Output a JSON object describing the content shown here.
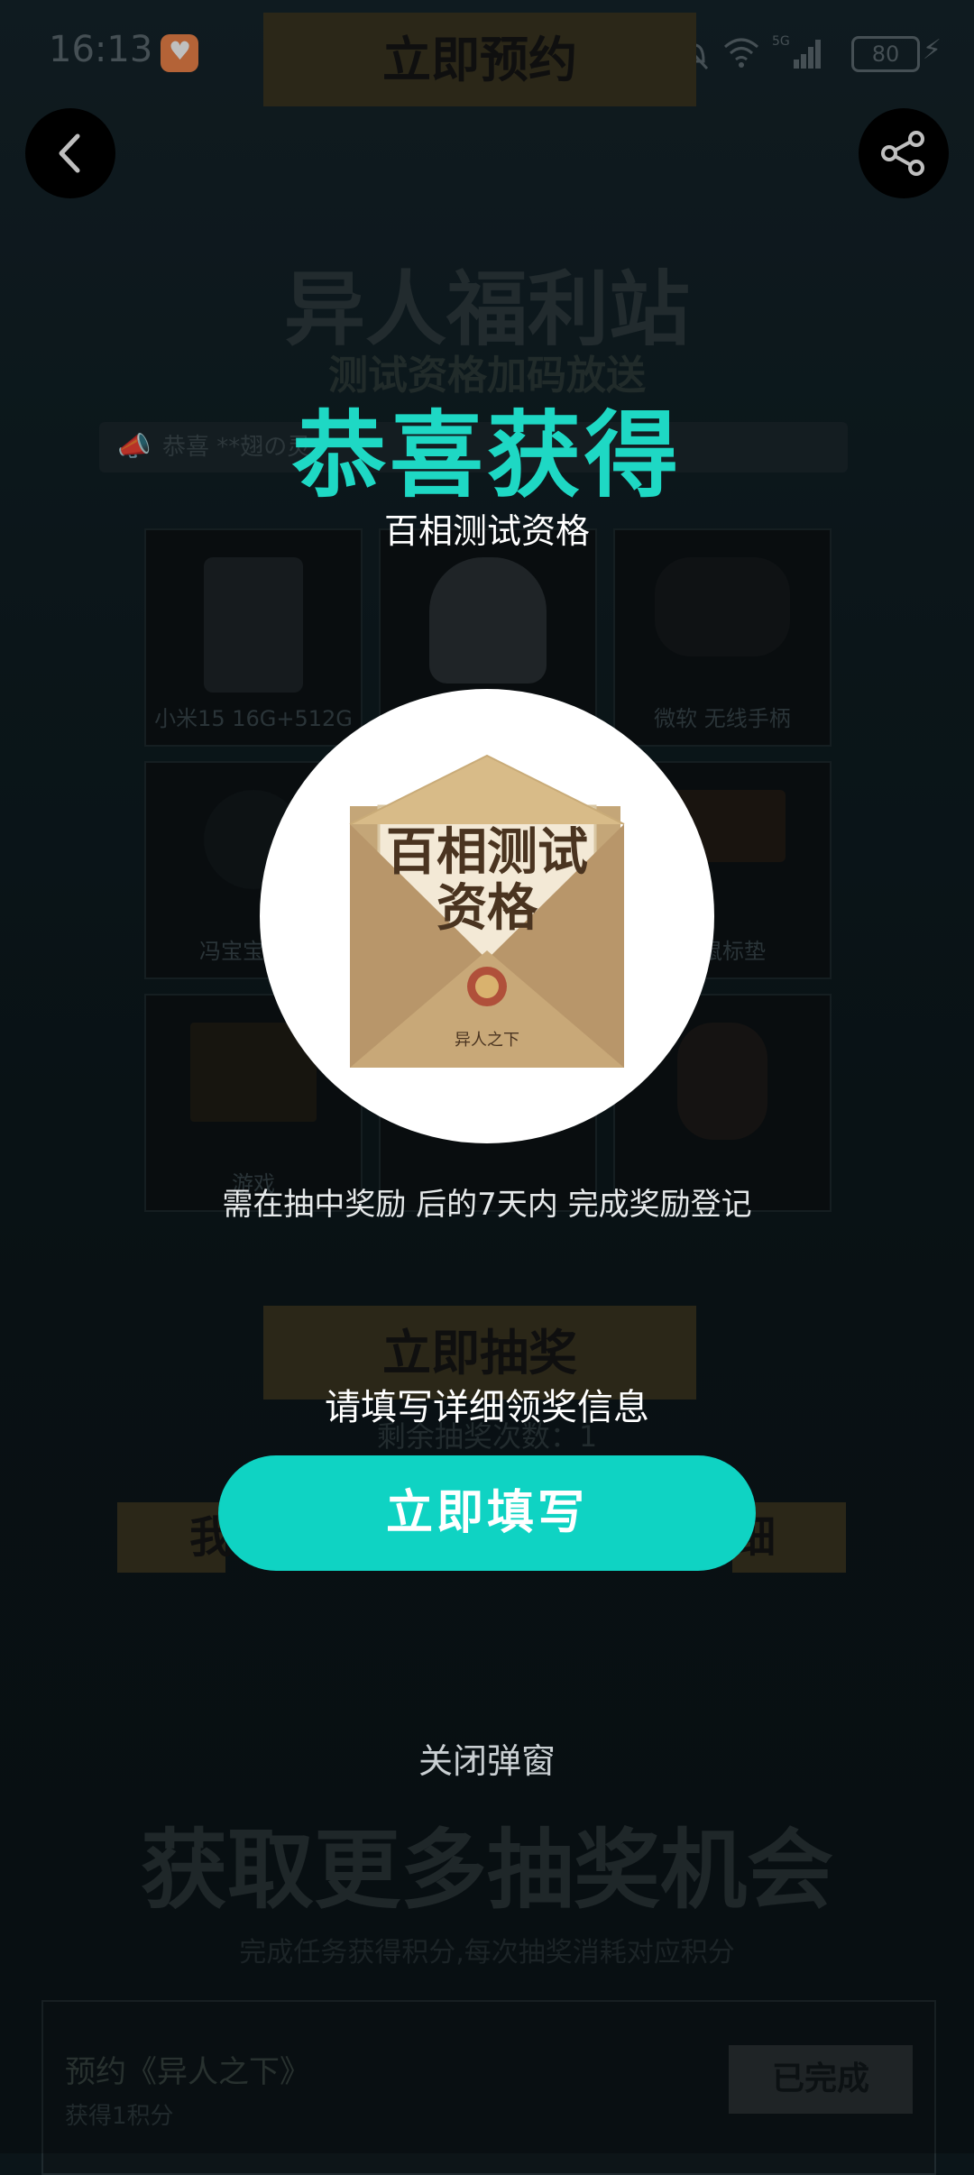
{
  "status_bar": {
    "time": "16:13",
    "icons": [
      "bluetooth-icon",
      "bell-off-icon",
      "wifi-icon",
      "5g-signal-icon"
    ],
    "battery": "80"
  },
  "header": {
    "top_button": "立即预约",
    "back_icon": "chevron-left-icon",
    "share_icon": "share-icon"
  },
  "background": {
    "title": "异人福利站",
    "subtitle": "测试资格加码放送",
    "ticker": "恭喜 **翅の灵",
    "prizes": [
      {
        "label": "小米15 16G+512G"
      },
      {
        "label": ""
      },
      {
        "label": "微软 无线手柄"
      },
      {
        "label": "冯宝宝冬日"
      },
      {
        "label": ""
      },
      {
        "label": "边鼠标垫"
      },
      {
        "label": "游戏"
      },
      {
        "label": ""
      },
      {
        "label": ""
      }
    ],
    "draw_button": "立即抽奖",
    "remaining": "剩余抽奖次数：1",
    "tab_left": "我",
    "tab_right": "细",
    "more_title": "获取更多抽奖机会",
    "more_subtitle": "完成任务获得积分,每次抽奖消耗对应积分",
    "task": {
      "name": "预约《异人之下》",
      "points": "获得1积分",
      "button": "已完成"
    }
  },
  "modal": {
    "congrats": "恭喜获得",
    "prize_name": "百相测试资格",
    "envelope_text_line1": "百相测试",
    "envelope_text_line2": "资格",
    "envelope_seal": "异人之下",
    "deadline": "需在抽中奖励 后的7天内 完成奖励登记",
    "fill_prompt": "请填写详细领奖信息",
    "fill_button": "立即填写",
    "close": "关闭弹窗"
  },
  "colors": {
    "accent": "#0fd3c3",
    "congrats": "#1ed8c4",
    "background": "#0b1519"
  }
}
